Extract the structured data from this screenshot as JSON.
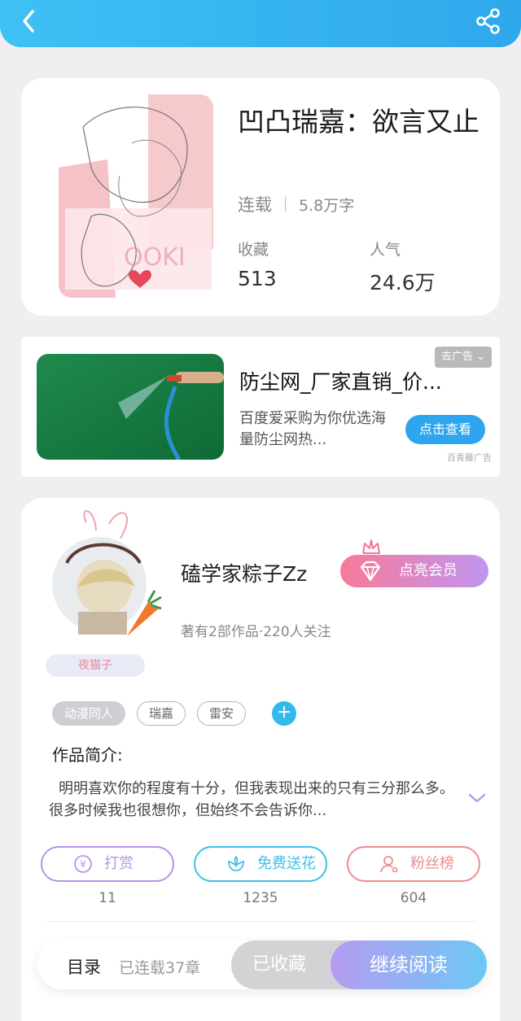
{
  "header": {
    "back_icon": "chevron-left-icon",
    "share_icon": "share-icon"
  },
  "book": {
    "title": "凹凸瑞嘉：欲言又止",
    "status": "连载",
    "words": "5.8万字",
    "collect_label": "收藏",
    "collect_value": "513",
    "popularity_label": "人气",
    "popularity_value": "24.6万"
  },
  "ad": {
    "tag": "去广告",
    "title": "防尘网_厂家直销_价...",
    "desc": "百度爱采购为你优选海量防尘网热...",
    "button": "点击查看",
    "source": "百青藤广告"
  },
  "author": {
    "name": "磕学家粽子Zz",
    "vip_button": "点亮会员",
    "stats": "著有2部作品·220人关注",
    "badge": "夜猫子"
  },
  "tags": [
    "动漫同人",
    "瑞嘉",
    "雷安"
  ],
  "intro": {
    "label": "作品简介:",
    "text": "明明喜欢你的程度有十分，但我表现出来的只有三分那么多。很多时候我也很想你，但始终不会告诉你..."
  },
  "actions": [
    {
      "label": "打赏",
      "count": "11",
      "color": "#b693e6",
      "icon": "yen-icon"
    },
    {
      "label": "免费送花",
      "count": "1235",
      "color": "#3fc1ea",
      "icon": "flower-icon"
    },
    {
      "label": "粉丝榜",
      "count": "604",
      "color": "#ee8b8e",
      "icon": "user-icon"
    }
  ],
  "bottom": {
    "toc": "目录",
    "chapters": "已连载37章",
    "collected": "已收藏",
    "continue": "继续阅读"
  }
}
